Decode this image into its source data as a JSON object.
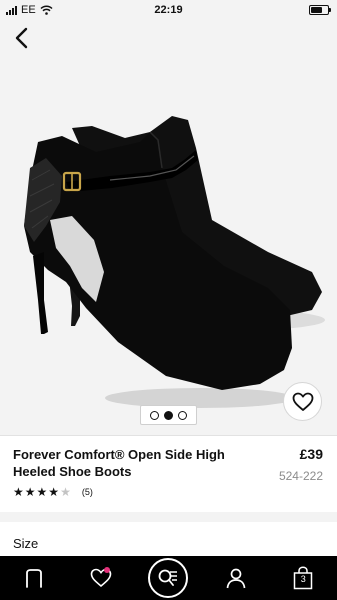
{
  "status": {
    "carrier": "EE",
    "time": "22:19"
  },
  "product": {
    "title": "Forever Comfort® Open Side High Heeled Shoe Boots",
    "price": "£39",
    "code": "524-222",
    "rating": 4,
    "rating_max": 5,
    "review_count": "(5)"
  },
  "gallery": {
    "slides": 3,
    "active": 2
  },
  "size": {
    "label": "Size"
  },
  "tabbar": {
    "bag_count": "3"
  },
  "colors": {
    "accent": "#e5307a",
    "tabbar_bg": "#000000"
  },
  "icons": [
    "back-icon",
    "heart-icon",
    "home-icon",
    "wishlist-icon",
    "search-icon",
    "account-icon",
    "bag-icon"
  ]
}
